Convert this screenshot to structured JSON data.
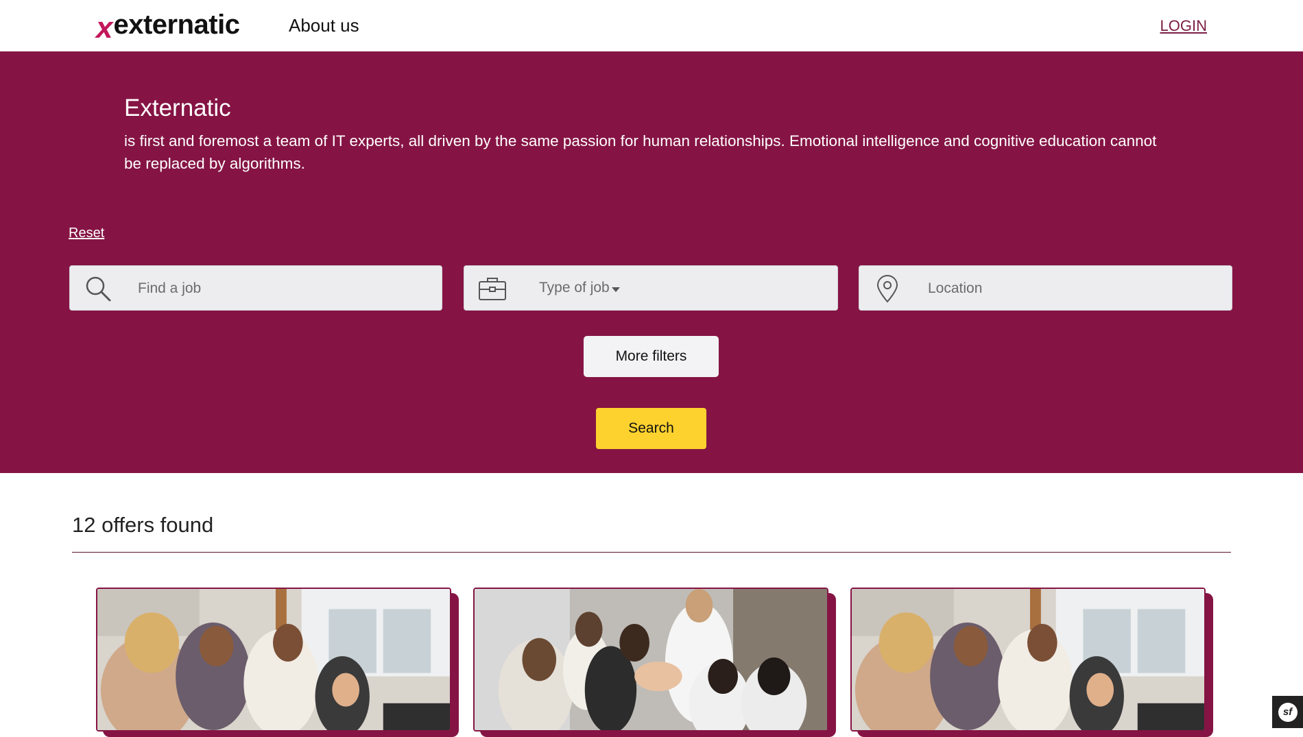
{
  "header": {
    "logo_x": "x",
    "logo_word": "externatic",
    "nav_about": "About us",
    "login": "LOGIN"
  },
  "hero": {
    "title": "Externatic",
    "description": "is first and foremost a team of IT experts, all driven by the same passion for human relationships. Emotional intelligence and cognitive education cannot be replaced by algorithms."
  },
  "filters": {
    "reset": "Reset",
    "find_placeholder": "Find a job",
    "type_label": "Type of job",
    "location_placeholder": "Location",
    "more_filters": "More filters",
    "search": "Search"
  },
  "results": {
    "title": "12 offers found",
    "cards": [
      {
        "image": "office-team-photo"
      },
      {
        "image": "team-high-five-photo"
      },
      {
        "image": "office-team-photo"
      }
    ]
  },
  "icons": {
    "search": "search-icon",
    "type": "briefcase-icon",
    "location": "location-pin-icon",
    "toolbar": "symfony-icon"
  },
  "colors": {
    "brand": "#851444",
    "accent_yellow": "#fdd22f",
    "logo_x": "#c2185b"
  }
}
